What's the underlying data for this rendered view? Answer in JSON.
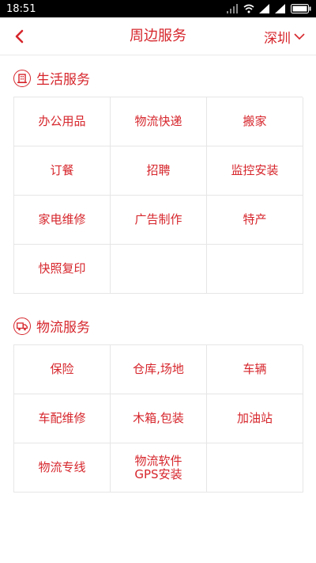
{
  "status_bar": {
    "time": "18:51"
  },
  "header": {
    "title": "周边服务",
    "city": "深圳"
  },
  "life_services": {
    "title": "生活服务",
    "items": [
      "办公用品",
      "物流快递",
      "搬家",
      "订餐",
      "招聘",
      "监控安装",
      "家电维修",
      "广告制作",
      "特产",
      "快照复印",
      "",
      ""
    ]
  },
  "logistics_services": {
    "title": "物流服务",
    "items": [
      "保险",
      "仓库,场地",
      "车辆",
      "车配维修",
      "木箱,包装",
      "加油站",
      "物流专线",
      "物流软件\nGPS安装",
      ""
    ]
  },
  "icons": {
    "back": "back-arrow-icon",
    "city_dropdown": "chevron-down-icon",
    "life": "building-icon",
    "logistics": "truck-icon"
  },
  "colors": {
    "accent": "#d6262c",
    "divider": "#e6e6e6",
    "status_bar_bg": "#000000"
  }
}
